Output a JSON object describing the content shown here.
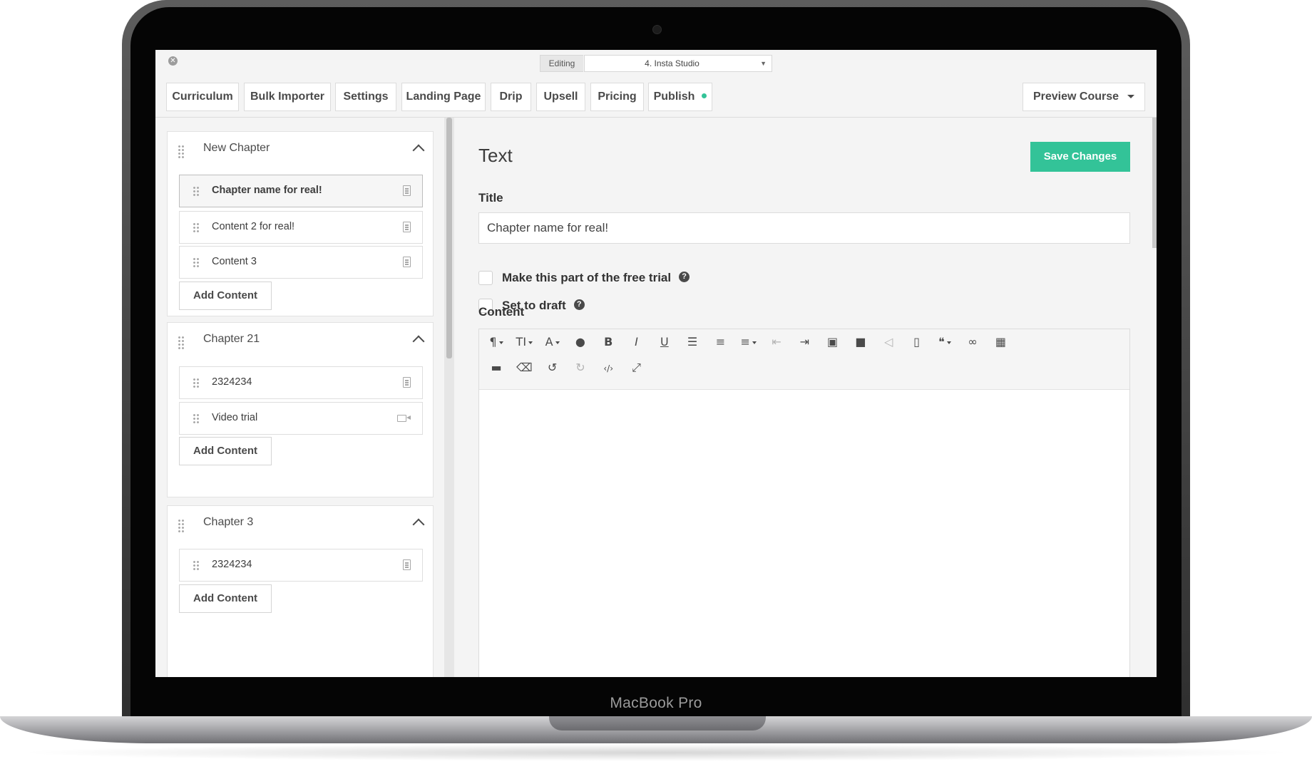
{
  "device": {
    "brand_label": "MacBook Pro"
  },
  "topbar": {
    "editing_label": "Editing",
    "course_selected": "4. Insta Studio"
  },
  "tabs": [
    "Curriculum",
    "Bulk Importer",
    "Settings",
    "Landing Page",
    "Drip",
    "Upsell",
    "Pricing",
    "Publish"
  ],
  "preview_button": "Preview Course",
  "colors": {
    "accent": "#33c398",
    "screen_bg": "#f4f4f4"
  },
  "sidebar": {
    "chapters": [
      {
        "title": "New Chapter",
        "items": [
          {
            "label": "Chapter name for real!",
            "type": "text",
            "selected": true
          },
          {
            "label": "Content 2 for real!",
            "type": "text"
          },
          {
            "label": "Content 3",
            "type": "text"
          }
        ],
        "add_label": "Add Content"
      },
      {
        "title": "Chapter 21",
        "items": [
          {
            "label": "2324234",
            "type": "text"
          },
          {
            "label": "Video trial",
            "type": "video"
          }
        ],
        "add_label": "Add Content"
      },
      {
        "title": "Chapter 3",
        "items": [
          {
            "label": "2324234",
            "type": "text"
          }
        ],
        "add_label": "Add Content"
      }
    ]
  },
  "editor": {
    "panel_title": "Text",
    "save_label": "Save Changes",
    "title_label": "Title",
    "title_value": "Chapter name for real!",
    "free_trial_label": "Make this part of the free trial",
    "free_trial_checked": false,
    "draft_label": "Set to draft",
    "draft_checked": false,
    "content_label": "Content",
    "toolbar": [
      {
        "name": "paragraph-format-icon",
        "glyph": "¶",
        "dropdown": true
      },
      {
        "name": "font-size-icon",
        "glyph": "TI",
        "dropdown": true
      },
      {
        "name": "font-family-icon",
        "glyph": "A",
        "dropdown": true
      },
      {
        "name": "text-color-icon",
        "glyph": "●"
      },
      {
        "name": "bold-icon",
        "glyph": "B"
      },
      {
        "name": "italic-icon",
        "glyph": "I"
      },
      {
        "name": "underline-icon",
        "glyph": "U"
      },
      {
        "name": "bullet-list-icon",
        "glyph": "☰"
      },
      {
        "name": "numbered-list-icon",
        "glyph": "≡"
      },
      {
        "name": "align-icon",
        "glyph": "≡",
        "dropdown": true
      },
      {
        "name": "outdent-icon",
        "glyph": "⇤",
        "muted": true
      },
      {
        "name": "indent-icon",
        "glyph": "⇥"
      },
      {
        "name": "image-icon",
        "glyph": "▣"
      },
      {
        "name": "video-icon",
        "glyph": "■"
      },
      {
        "name": "audio-icon",
        "glyph": "◁",
        "muted": true
      },
      {
        "name": "file-icon",
        "glyph": "▯"
      },
      {
        "name": "quote-icon",
        "glyph": "❝",
        "dropdown": true
      },
      {
        "name": "link-icon",
        "glyph": "∞"
      },
      {
        "name": "table-icon",
        "glyph": "▦"
      },
      {
        "name": "horizontal-rule-icon",
        "glyph": "▬"
      },
      {
        "name": "clear-format-icon",
        "glyph": "⌫"
      },
      {
        "name": "undo-icon",
        "glyph": "↺"
      },
      {
        "name": "redo-icon",
        "glyph": "↻",
        "muted": true
      },
      {
        "name": "code-view-icon",
        "glyph": "‹/›"
      },
      {
        "name": "fullscreen-icon",
        "glyph": "⤢"
      }
    ]
  }
}
